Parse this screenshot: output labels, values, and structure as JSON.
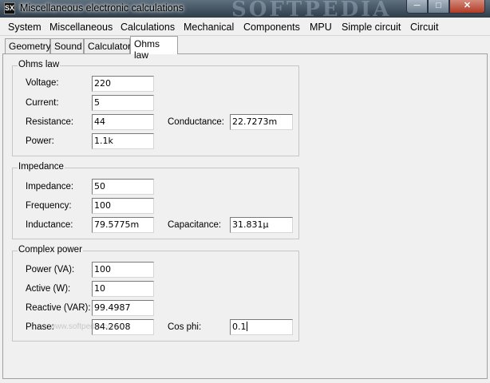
{
  "window": {
    "title": "Miscellaneous electronic calculations",
    "app_icon_text": "SX",
    "watermark": "SOFTPEDIA",
    "minimize_icon": "minimize-icon",
    "maximize_icon": "maximize-icon",
    "close_icon": "close-icon"
  },
  "menu": [
    "System",
    "Miscellaneous",
    "Calculations",
    "Mechanical",
    "Components",
    "MPU",
    "Simple circuit",
    "Circuit"
  ],
  "tabs": [
    "Geometry",
    "Sound",
    "Calculator",
    "Ohms law"
  ],
  "active_tab": "Ohms law",
  "ohms_law": {
    "title": "Ohms law",
    "voltage_label": "Voltage:",
    "voltage": "220",
    "current_label": "Current:",
    "current": "5",
    "resistance_label": "Resistance:",
    "resistance": "44",
    "conductance_label": "Conductance:",
    "conductance": "22.7273m",
    "power_label": "Power:",
    "power": "1.1k"
  },
  "impedance": {
    "title": "Impedance",
    "impedance_label": "Impedance:",
    "impedance": "50",
    "frequency_label": "Frequency:",
    "frequency": "100",
    "inductance_label": "Inductance:",
    "inductance": "79.5775m",
    "capacitance_label": "Capacitance:",
    "capacitance": "31.831µ"
  },
  "complex_power": {
    "title": "Complex power",
    "power_va_label": "Power (VA):",
    "power_va": "100",
    "active_label": "Active (W):",
    "active": "10",
    "reactive_label": "Reactive (VAR):",
    "reactive": "99.4987",
    "phase_label": "Phase:",
    "phase": "84.2608",
    "cos_phi_label": "Cos phi:",
    "cos_phi": "0.1"
  },
  "watermark_small": "www.softpedia.com"
}
